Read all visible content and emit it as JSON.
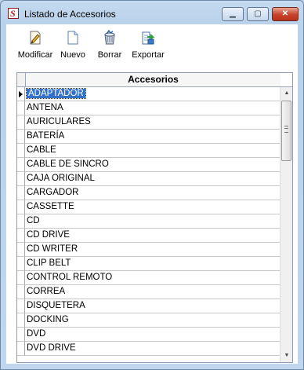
{
  "window": {
    "title": "Listado de Accesorios",
    "controls": {
      "minimize": "▁",
      "maximize": "▢",
      "close": "✕"
    }
  },
  "toolbar": {
    "items": [
      {
        "label": "Modificar",
        "icon": "edit-document-icon"
      },
      {
        "label": "Nuevo",
        "icon": "new-document-icon"
      },
      {
        "label": "Borrar",
        "icon": "recycle-bin-icon"
      },
      {
        "label": "Exportar",
        "icon": "export-icon"
      }
    ]
  },
  "grid": {
    "column_header": "Accesorios",
    "selected_row": 0,
    "rows": [
      "ADAPTADOR",
      "ANTENA",
      "AURICULARES",
      "BATERÍA",
      "CABLE",
      "CABLE DE SINCRO",
      "CAJA ORIGINAL",
      "CARGADOR",
      "CASSETTE",
      "CD",
      "CD DRIVE",
      "CD WRITER",
      "CLIP BELT",
      "CONTROL REMOTO",
      "CORREA",
      "DISQUETERA",
      "DOCKING",
      "DVD",
      "DVD DRIVE"
    ],
    "scroll": {
      "up": "▲",
      "down": "▼"
    }
  },
  "colors": {
    "selection": "#3472c8",
    "window_frame": "#bcd3ea"
  }
}
